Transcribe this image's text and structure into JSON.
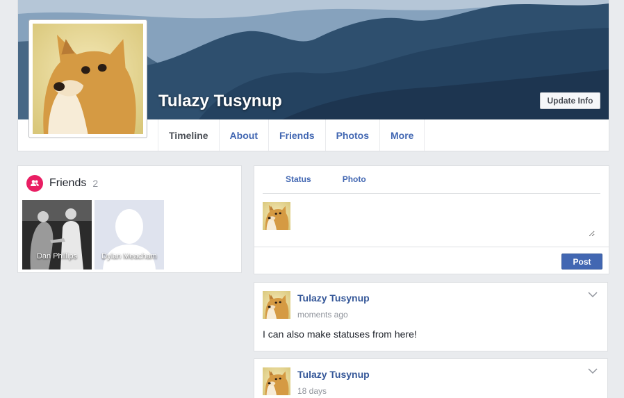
{
  "profile": {
    "name": "Tulazy Tusynup",
    "update_info_label": "Update Info"
  },
  "nav": {
    "items": [
      {
        "label": "Timeline",
        "active": true
      },
      {
        "label": "About",
        "active": false
      },
      {
        "label": "Friends",
        "active": false
      },
      {
        "label": "Photos",
        "active": false
      },
      {
        "label": "More",
        "active": false
      }
    ]
  },
  "friends": {
    "title": "Friends",
    "count": "2",
    "list": [
      {
        "name": "Dan Phillips"
      },
      {
        "name": "Dylan Meacham"
      }
    ]
  },
  "composer": {
    "tabs": [
      "Status",
      "Photo"
    ],
    "placeholder": "",
    "post_label": "Post"
  },
  "posts": [
    {
      "author": "Tulazy Tusynup",
      "time": "moments ago",
      "text": "I can also make statuses from here!"
    },
    {
      "author": "Tulazy Tusynup",
      "time": "18 days",
      "text": ""
    }
  ],
  "colors": {
    "brand": "#4267b2",
    "link": "#365899",
    "friends_icon": "#e91e63",
    "page_bg": "#e9ebee"
  },
  "icons": {
    "friends": "people-icon",
    "post_menu": "chevron-down-icon"
  }
}
